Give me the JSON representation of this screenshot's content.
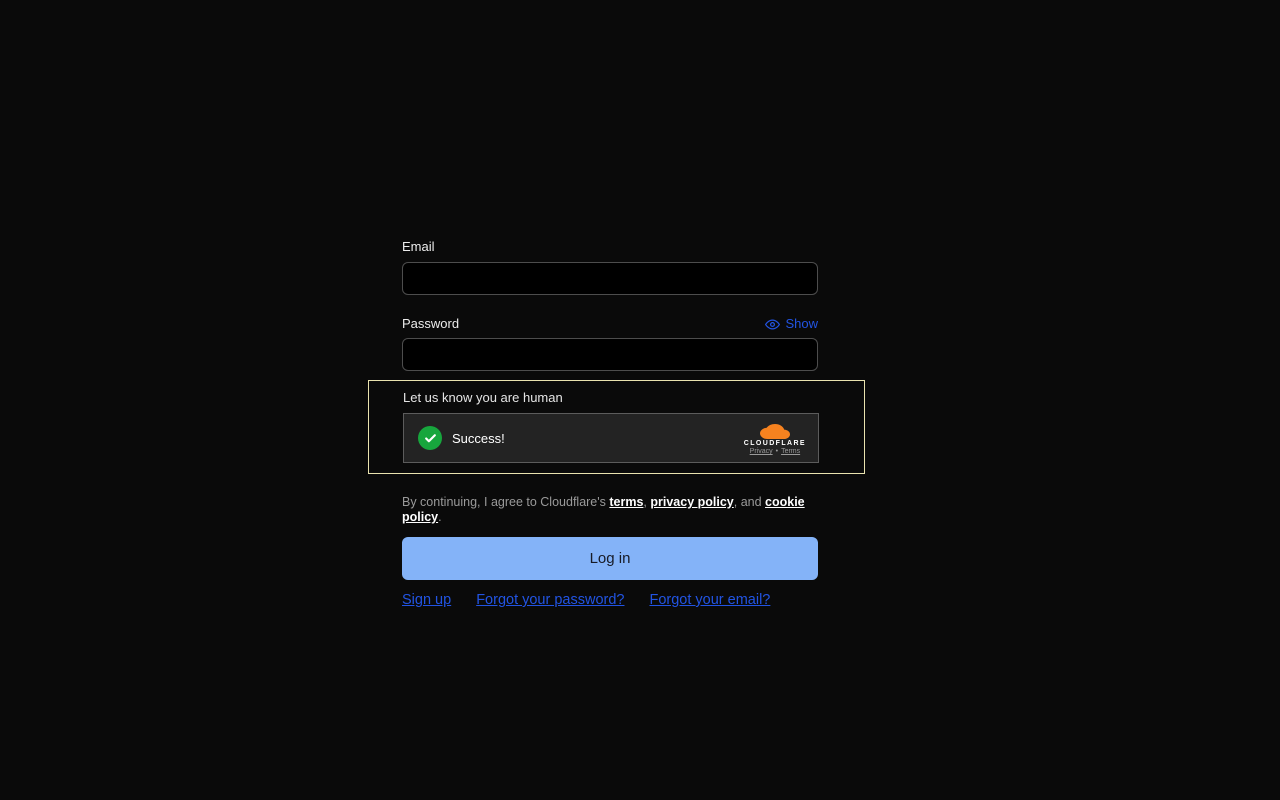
{
  "login_form": {
    "email": {
      "label": "Email",
      "value": "",
      "placeholder": ""
    },
    "password": {
      "label": "Password",
      "value": "",
      "placeholder": "",
      "show_toggle": "Show"
    },
    "human_verification": {
      "heading": "Let us know you are human",
      "turnstile": {
        "status_text": "Success!",
        "brand_name": "CLOUDFLARE",
        "privacy_link": "Privacy",
        "link_separator": "•",
        "terms_link": "Terms"
      }
    },
    "agreement": {
      "text_before": "By continuing, I agree to Cloudflare's ",
      "terms_link": "terms",
      "sep_after_terms": ", ",
      "privacy_link": "privacy policy",
      "sep_after_privacy": ", and ",
      "cookie_link": "cookie policy",
      "text_after": "."
    },
    "submit_button": "Log in",
    "footer_links": [
      {
        "label": "Sign up"
      },
      {
        "label": "Forgot your password?"
      },
      {
        "label": "Forgot your email?"
      }
    ]
  },
  "colors": {
    "page_background": "#0a0a0a",
    "link_blue": "#2254e3",
    "button_blue": "#84b3f8",
    "button_text": "#171b26",
    "success_green": "#17a63d",
    "highlight_border": "#e9e3af",
    "turnstile_background": "#232323",
    "cloudflare_orange": "#f6821f"
  }
}
